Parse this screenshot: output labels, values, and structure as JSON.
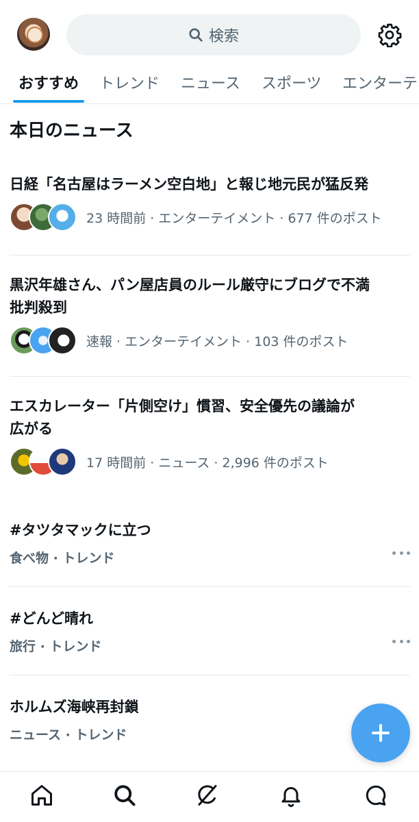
{
  "search": {
    "label": "検索"
  },
  "tabs": [
    {
      "label": "おすすめ"
    },
    {
      "label": "トレンド"
    },
    {
      "label": "ニュース"
    },
    {
      "label": "スポーツ"
    },
    {
      "label": "エンターテ"
    }
  ],
  "section_title": "本日のニュース",
  "news": [
    {
      "headline": "日経「名古屋はラーメン空白地」と報じ地元民が猛反発",
      "meta": "23 時間前 · エンターテイメント · 677 件のポスト"
    },
    {
      "headline_line1": "黒沢年雄さん、パン屋店員のルール厳守にブログで不満",
      "headline_line2": "批判殺到",
      "meta": "速報 · エンターテイメント · 103 件のポスト"
    },
    {
      "headline_line1": "エスカレーター「片側空け」慣習、安全優先の議論が",
      "headline_line2": "広がる",
      "meta": "17 時間前 · ニュース · 2,996 件のポスト"
    }
  ],
  "trends": [
    {
      "title": "#タツタマックに立つ",
      "meta": "食べ物 · トレンド"
    },
    {
      "title": "#どんど晴れ",
      "meta": "旅行 · トレンド"
    },
    {
      "title": "ホルムズ海峡再封鎖",
      "meta": "ニュース · トレンド"
    }
  ],
  "colors": {
    "accent": "#1d9bf0",
    "fab": "#4aa3f0",
    "secondary_text": "#536471"
  }
}
